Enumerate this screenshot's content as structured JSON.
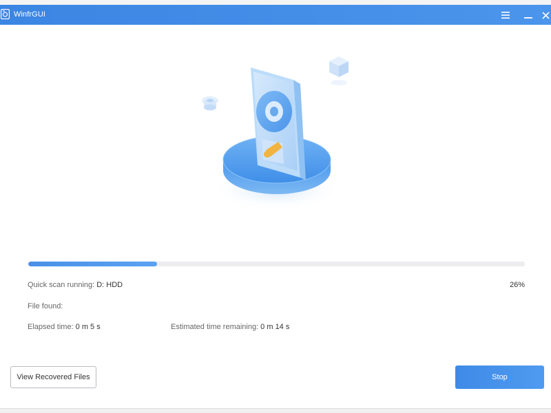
{
  "window": {
    "title": "WinfrGUI",
    "controls": [
      "menu-icon",
      "minimize-icon",
      "close-icon"
    ]
  },
  "scan": {
    "status_label": "Quick scan running:",
    "drive": "D: HDD",
    "progress_percent": 26,
    "percent_text": "26%",
    "files_found_label": "File found:",
    "files_found_value": "",
    "elapsed_label": "Elapsed time:",
    "elapsed_value": "0 m 5 s",
    "remaining_label": "Estimated time remaining:",
    "remaining_value": "0 m 14 s"
  },
  "actions": {
    "view_recovered": "View Recovered Files",
    "stop": "Stop"
  },
  "colors": {
    "accent": "#4a90e8",
    "titlebar": "#3c86e3",
    "track": "#ededf0"
  }
}
